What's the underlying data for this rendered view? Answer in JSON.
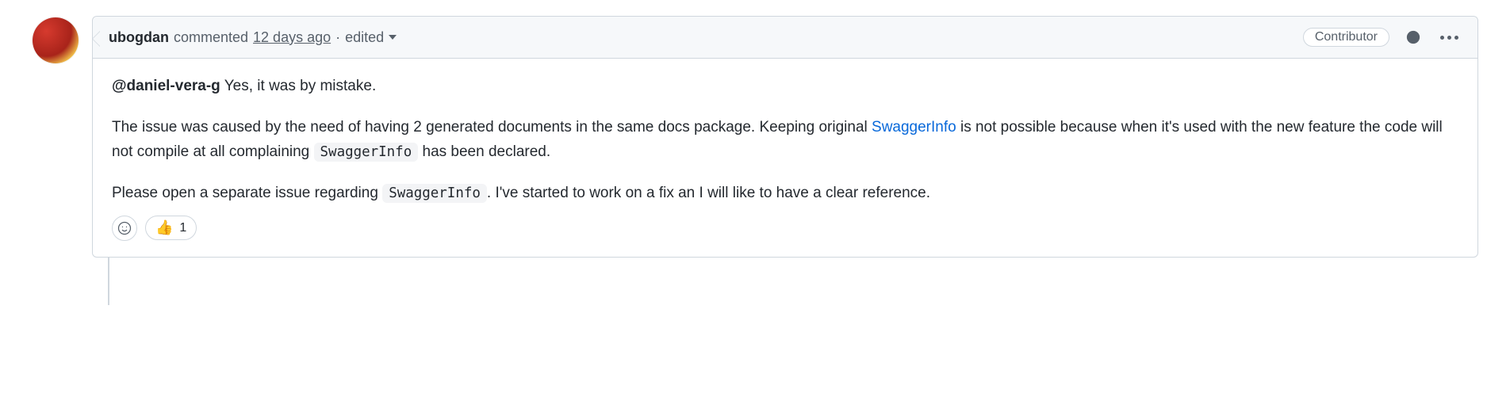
{
  "comment": {
    "author": "ubogdan",
    "action_prefix": "commented",
    "timestamp": "12 days ago",
    "separator": "·",
    "edited_label": "edited",
    "badge": "Contributor",
    "body": {
      "p1": {
        "mention": "@daniel-vera-g",
        "text_after_mention": " Yes, it was by mistake."
      },
      "p2": {
        "before_link": "The issue was caused by the need of having 2 generated documents in the same docs package. Keeping original ",
        "link_text": "SwaggerInfo",
        "after_link_before_code": " is not possible because when it's used with the new feature the code will not compile at all complaining ",
        "code1": "SwaggerInfo",
        "after_code1": " has been declared."
      },
      "p3": {
        "before_code": "Please open a separate issue regarding ",
        "code2": "SwaggerInfo",
        "after_code": ". I've started to work on a fix an I will like to have a clear reference."
      }
    },
    "reactions": {
      "thumbs_up_emoji": "👍",
      "thumbs_up_count": "1"
    }
  }
}
